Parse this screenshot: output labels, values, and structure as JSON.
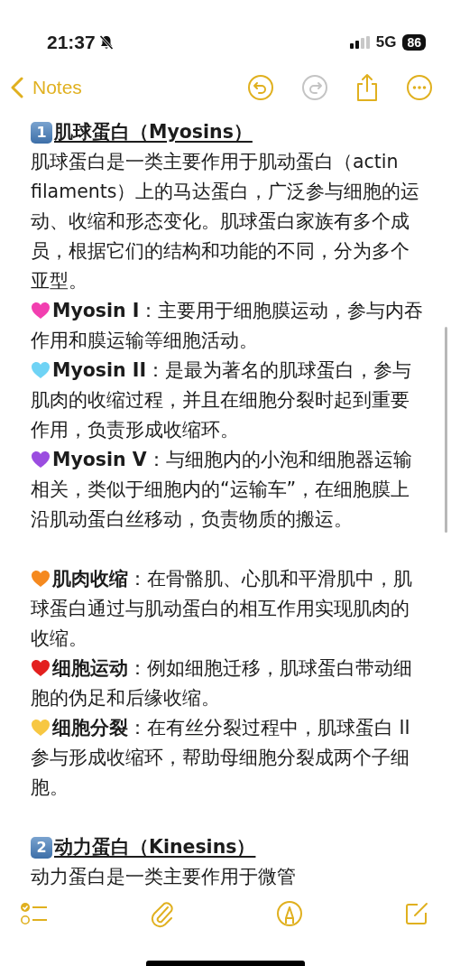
{
  "status_bar": {
    "time": "21:37",
    "network": "5G",
    "battery": "86"
  },
  "nav": {
    "back_label": "Notes",
    "actions": [
      {
        "kind": "undo",
        "disabled": false
      },
      {
        "kind": "redo",
        "disabled": true
      },
      {
        "kind": "share",
        "disabled": false
      },
      {
        "kind": "more",
        "disabled": false
      }
    ]
  },
  "blocks": [
    {
      "kind": "heading",
      "number": "1",
      "title": "肌球蛋白（Myosins）"
    },
    {
      "kind": "text",
      "text": "肌球蛋白是一类主要作用于肌动蛋白（actin filaments）上的马达蛋白，广泛参与细胞的运动、收缩和形态变化。肌球蛋白家族有多个成员，根据它们的结构和功能的不同，分为多个亚型。"
    },
    {
      "kind": "list",
      "items": [
        {
          "color": "#f23fb0",
          "text": "**Myosin I**：主要用于细胞膜运动，参与内吞作用和膜运输等细胞活动。"
        },
        {
          "color": "#6fd3f5",
          "text": "**Myosin II**：是最为著名的肌球蛋白，参与肌肉的收缩过程，并且在细胞分裂时起到重要作用，负责形成收缩环。"
        },
        {
          "color": "#9b4de0",
          "text": "**Myosin V**：与细胞内的小泡和细胞器运输相关，类似于细胞内的“运输车”，在细胞膜上沿肌动蛋白丝移动，负责物质的搬运。"
        }
      ]
    },
    {
      "kind": "list",
      "items": [
        {
          "color": "#f5891f",
          "text": "**肌肉收缩**：在骨骼肌、心肌和平滑肌中，肌球蛋白通过与肌动蛋白的相互作用实现肌肉的收缩。"
        },
        {
          "color": "#e3201f",
          "text": "**细胞运动**：例如细胞迁移，肌球蛋白带动细胞的伪足和后缘收缩。"
        },
        {
          "color": "#f7c742",
          "text": "**细胞分裂**：在有丝分裂过程中，肌球蛋白 II 参与形成收缩环，帮助母细胞分裂成两个子细胞。"
        }
      ]
    },
    {
      "kind": "heading",
      "number": "2",
      "title": "动力蛋白（Kinesins）"
    },
    {
      "kind": "text",
      "text": "动力蛋白是一类主要作用于微管"
    }
  ],
  "toolbar": [
    {
      "kind": "checklist"
    },
    {
      "kind": "attach"
    },
    {
      "kind": "markup"
    },
    {
      "kind": "compose"
    }
  ]
}
